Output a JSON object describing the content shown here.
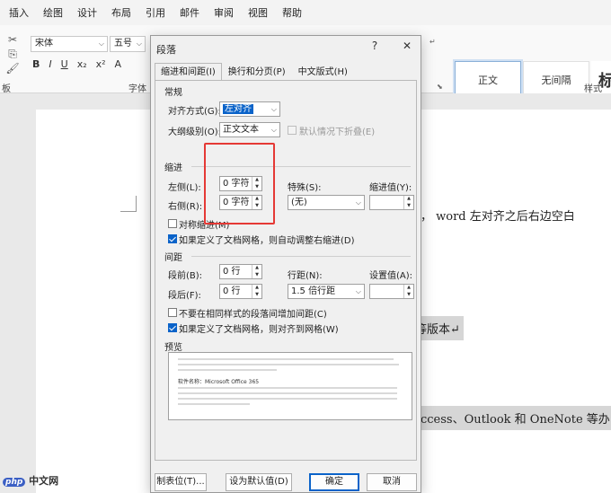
{
  "menubar": {
    "items": [
      "插入",
      "绘图",
      "设计",
      "布局",
      "引用",
      "邮件",
      "审阅",
      "视图",
      "帮助"
    ]
  },
  "ribbon": {
    "font_name": "宋体",
    "font_size": "五号",
    "font_group_label": "字体",
    "clipboard_label": "板",
    "styles_label": "样式",
    "styles": [
      "正文",
      "无间隔",
      "标"
    ],
    "format_buttons": [
      "B",
      "I",
      "U",
      "x₂",
      "x²",
      "A"
    ]
  },
  "dialog": {
    "title": "段落",
    "help": "?",
    "close": "✕",
    "tabs": [
      "缩进和间距(I)",
      "换行和分页(P)",
      "中文版式(H)"
    ],
    "general": {
      "title": "常规",
      "alignment_label": "对齐方式(G):",
      "alignment_value": "左对齐",
      "outline_label": "大纲级别(O):",
      "outline_value": "正文文本",
      "collapse_label": "默认情况下折叠(E)"
    },
    "indent": {
      "title": "缩进",
      "left_label": "左侧(L):",
      "left_value": "0 字符",
      "right_label": "右侧(R):",
      "right_value": "0 字符",
      "special_label": "特殊(S):",
      "special_value": "(无)",
      "indent_value_label": "缩进值(Y):",
      "indent_value": "",
      "mirror_label": "对称缩进(M)",
      "auto_adjust_label": "如果定义了文档网格，则自动调整右缩进(D)"
    },
    "spacing": {
      "title": "间距",
      "before_label": "段前(B):",
      "before_value": "0 行",
      "after_label": "段后(F):",
      "after_value": "0 行",
      "line_spacing_label": "行距(N):",
      "line_spacing_value": "1.5 倍行距",
      "setting_label": "设置值(A):",
      "setting_value": "",
      "no_space_label": "不要在相同样式的段落间增加间距(C)",
      "snap_grid_label": "如果定义了文档网格，则对齐到网格(W)"
    },
    "preview": {
      "title": "预览",
      "sample_text": "软件名称：Microsoft Office 365"
    },
    "buttons": {
      "tabs": "制表位(T)...",
      "default": "设为默认值(D)",
      "ok": "确定",
      "cancel": "取消"
    }
  },
  "document": {
    "line1": "，  word 左对齐之后右边空白",
    "line2": "等版本↵",
    "line3": "ccess、Outlook 和 OneNote 等办"
  },
  "watermark": {
    "brand": "php",
    "text": "中文网"
  },
  "colors": {
    "accent": "#0b63c9",
    "highlight_box": "#e53935"
  }
}
